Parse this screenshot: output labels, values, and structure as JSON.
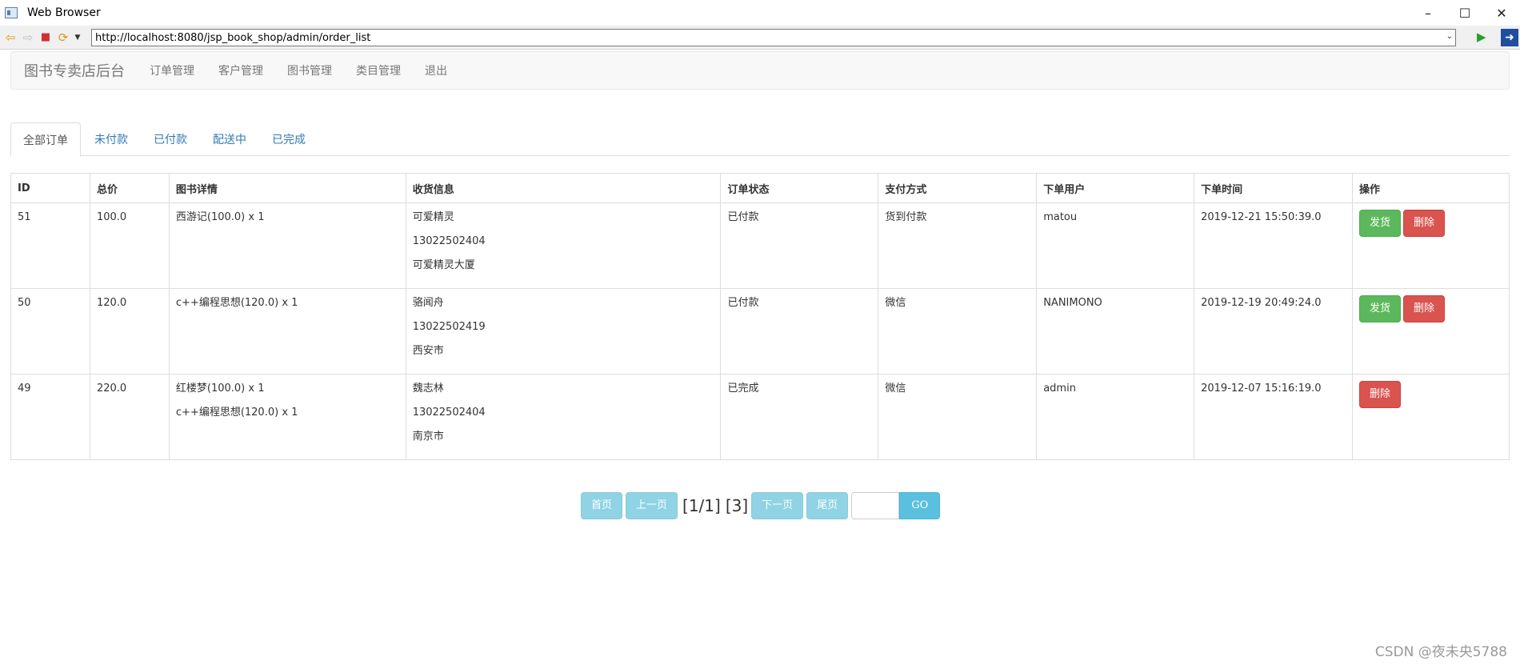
{
  "window": {
    "title": "Web Browser",
    "minimize": "–",
    "maximize": "☐",
    "close": "✕"
  },
  "browser": {
    "url": "http://localhost:8080/jsp_book_shop/admin/order_list"
  },
  "navbar": {
    "brand": "图书专卖店后台",
    "links": [
      "订单管理",
      "客户管理",
      "图书管理",
      "类目管理",
      "退出"
    ]
  },
  "tabs": [
    "全部订单",
    "未付款",
    "已付款",
    "配送中",
    "已完成"
  ],
  "table": {
    "headers": [
      "ID",
      "总价",
      "图书详情",
      "收货信息",
      "订单状态",
      "支付方式",
      "下单用户",
      "下单时间",
      "操作"
    ],
    "rows": [
      {
        "id": "51",
        "total": "100.0",
        "books": [
          "西游记(100.0) x 1"
        ],
        "receiver": [
          "可爱精灵",
          "13022502404",
          "可爱精灵大厦"
        ],
        "status": "已付款",
        "payment": "货到付款",
        "user": "matou",
        "time": "2019-12-21 15:50:39.0",
        "ship_label": "发货",
        "delete_label": "删除"
      },
      {
        "id": "50",
        "total": "120.0",
        "books": [
          "c++编程思想(120.0) x 1"
        ],
        "receiver": [
          "骆闻舟",
          "13022502419",
          "西安市"
        ],
        "status": "已付款",
        "payment": "微信",
        "user": "NANIMONO",
        "time": "2019-12-19 20:49:24.0",
        "ship_label": "发货",
        "delete_label": "删除"
      },
      {
        "id": "49",
        "total": "220.0",
        "books": [
          "红楼梦(100.0) x 1",
          "c++编程思想(120.0) x 1"
        ],
        "receiver": [
          "魏志林",
          "13022502404",
          "南京市"
        ],
        "status": "已完成",
        "payment": "微信",
        "user": "admin",
        "time": "2019-12-07 15:16:19.0",
        "delete_label": "删除"
      }
    ]
  },
  "pagination": {
    "first": "首页",
    "prev": "上一页",
    "page_info": "[1/1]",
    "total_info": "[3]",
    "next": "下一页",
    "last": "尾页",
    "go": "GO"
  },
  "watermark": "CSDN @夜未央5788",
  "colors": {
    "ship_button": "#5cb85c",
    "delete_button": "#d9534f",
    "paid_status": "#a94442",
    "link": "#337ab7",
    "pager_disabled": "#8fd3e4",
    "go_button": "#5bc0de"
  }
}
